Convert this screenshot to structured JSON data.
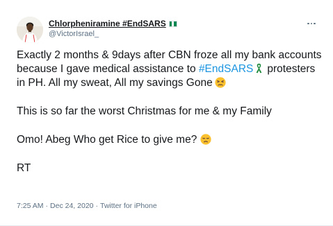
{
  "author": {
    "display_name": "Chlorpheniramine #EndSARS",
    "handle": "@VictorIsrael_",
    "flag_colors": [
      "#008751",
      "#ffffff",
      "#008751"
    ],
    "avatar_icon": "profile-photo"
  },
  "menu": {
    "icon": "more-options-icon"
  },
  "tweet": {
    "p1_a": "Exactly 2 months & 9days after CBN froze all my bank accounts because I gave medical assistance to ",
    "hashtag": "#EndSARS",
    "hashtag_icon": "green-ribbon-icon",
    "p1_b": "protesters in PH. All my sweat, All my savings Gone",
    "p1_emoji": "persevering-face-emoji",
    "p2": "This is so far the worst Christmas for me & my Family",
    "p3": "Omo! Abeg Who get Rice to give me?",
    "p3_emoji": "disappointed-face-emoji",
    "p4": "RT"
  },
  "meta": {
    "time": "7:25 AM",
    "separator": "·",
    "date": "Dec 24, 2020",
    "source": "Twitter for iPhone"
  },
  "colors": {
    "link": "#1b95e0",
    "text": "#14171a",
    "secondary": "#5b7083",
    "emoji": "#fbc02d"
  }
}
